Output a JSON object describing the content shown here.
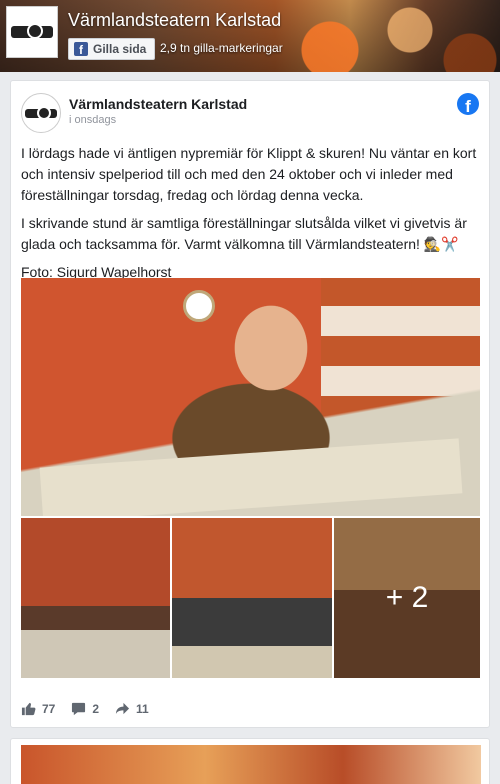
{
  "page_header": {
    "title": "Värmlandsteatern Karlstad",
    "like_button_label": "Gilla sida",
    "like_count": "2,9 tn gilla-markeringar"
  },
  "post": {
    "author": "Värmlandsteatern Karlstad",
    "time": "i onsdags",
    "paragraphs": [
      "I lördags hade vi äntligen nypremiär för Klippt & skuren! Nu väntar en kort och intensiv spelperiod till och med den 24 oktober och vi inleder med föreställningar torsdag, fredag och lördag denna vecka.",
      "I skrivande stund är samtliga föreställningar slutsålda vilket vi givetvis är glada och tacksamma för. Varmt välkomna till Värmlandsteatern! 🕵️✂️",
      "Foto: Sigurd Wapelhorst"
    ],
    "more_photos": "+ 2",
    "reactions": "77",
    "comments": "2",
    "shares": "11"
  },
  "colors": {
    "facebook_blue": "#1877f2",
    "card_background": "#ffffff",
    "page_background": "#e9ebee"
  },
  "icons": {
    "like": "thumbs-up-icon",
    "comment": "comment-bubble-icon",
    "share": "share-arrow-icon",
    "facebook": "facebook-logo-icon"
  }
}
